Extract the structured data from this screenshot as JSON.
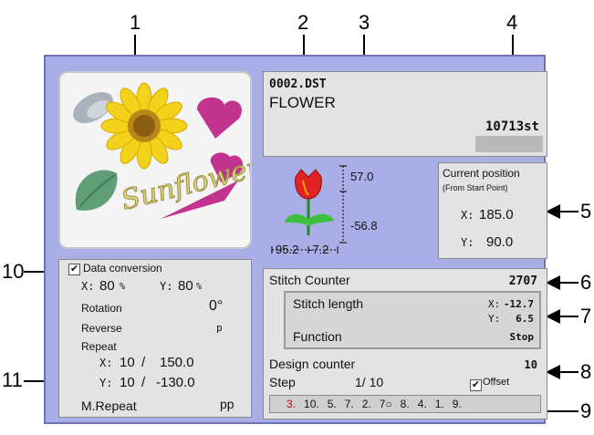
{
  "callouts": [
    "1",
    "2",
    "3",
    "4",
    "5",
    "6",
    "7",
    "8",
    "9",
    "10",
    "11"
  ],
  "design": {
    "file_name": "0002.DST",
    "name": "FLOWER",
    "stitch_total": "10713st",
    "preview_text": "Sunflower"
  },
  "dimensions": {
    "top": "57.0",
    "bottom": "-56.8",
    "left": "95.2",
    "right": "-7.2"
  },
  "position": {
    "title": "Current position",
    "subtitle": "(From Start Point)",
    "x_label": "X:",
    "x_value": "185.0",
    "y_label": "Y:",
    "y_value": "90.0"
  },
  "conversion": {
    "label": "Data conversion",
    "checked": true,
    "x_label": "X:",
    "x_value": "80",
    "x_unit": "%",
    "y_label": "Y:",
    "y_value": "80",
    "y_unit": "%",
    "rotation_label": "Rotation",
    "rotation_value": "0°",
    "reverse_label": "Reverse",
    "reverse_value": "p",
    "repeat_label": "Repeat",
    "repeat_x_label": "X:",
    "repeat_x_count": "10",
    "repeat_x_value": "150.0",
    "repeat_y_label": "Y:",
    "repeat_y_count": "10",
    "repeat_y_value": "-130.0",
    "slash": "/",
    "mrepeat_label": "M.Repeat",
    "mrepeat_value": "pp"
  },
  "stitch": {
    "counter_label": "Stitch Counter",
    "counter_value": "2707",
    "length_label": "Stitch length",
    "length_x_label": "X:",
    "length_x_value": "-12.7",
    "length_y_label": "Y:",
    "length_y_value": "6.5",
    "function_label": "Function",
    "function_value": "Stop"
  },
  "design_counter": {
    "label": "Design counter",
    "value": "10",
    "step_label": "Step",
    "step_value": "1/ 10",
    "offset_label": "Offset",
    "offset_checked": true
  },
  "sequence": {
    "current": "3.",
    "items": [
      "10.",
      "5.",
      "7.",
      "2.",
      "7○",
      "8.",
      "4.",
      "1.",
      "9."
    ]
  },
  "colors": {
    "screen_bg": "#a9aee6",
    "panel_bg": "#e3e3e3",
    "current_step": "#d40000"
  }
}
